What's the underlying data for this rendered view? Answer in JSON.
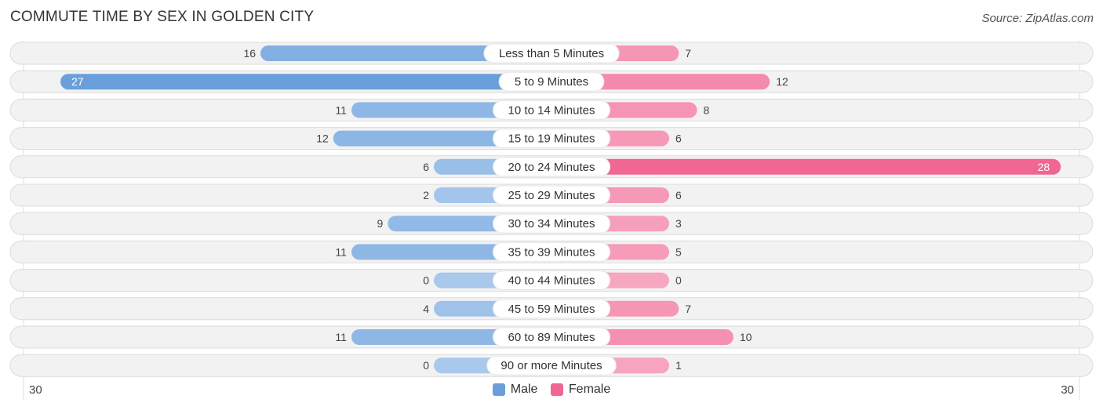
{
  "title": "COMMUTE TIME BY SEX IN GOLDEN CITY",
  "source": "Source: ZipAtlas.com",
  "legend": {
    "male_label": "Male",
    "female_label": "Female"
  },
  "axis": {
    "left_label": "30",
    "right_label": "30"
  },
  "colors": {
    "male": "#6a9fdb",
    "male_light": "#a8c8ec",
    "female": "#f06792",
    "female_light": "#f7a6c0",
    "track": "#f2f2f2"
  },
  "chart_data": {
    "type": "bar",
    "orientation": "horizontal-diverging",
    "title": "COMMUTE TIME BY SEX IN GOLDEN CITY",
    "xlim": [
      -30,
      30
    ],
    "xlabel": "",
    "ylabel": "",
    "legend_position": "bottom-center",
    "categories": [
      "Less than 5 Minutes",
      "5 to 9 Minutes",
      "10 to 14 Minutes",
      "15 to 19 Minutes",
      "20 to 24 Minutes",
      "25 to 29 Minutes",
      "30 to 34 Minutes",
      "35 to 39 Minutes",
      "40 to 44 Minutes",
      "45 to 59 Minutes",
      "60 to 89 Minutes",
      "90 or more Minutes"
    ],
    "series": [
      {
        "name": "Male",
        "values": [
          16,
          27,
          11,
          12,
          6,
          2,
          9,
          11,
          0,
          4,
          11,
          0
        ]
      },
      {
        "name": "Female",
        "values": [
          7,
          12,
          8,
          6,
          28,
          6,
          3,
          5,
          0,
          7,
          10,
          1
        ]
      }
    ]
  }
}
